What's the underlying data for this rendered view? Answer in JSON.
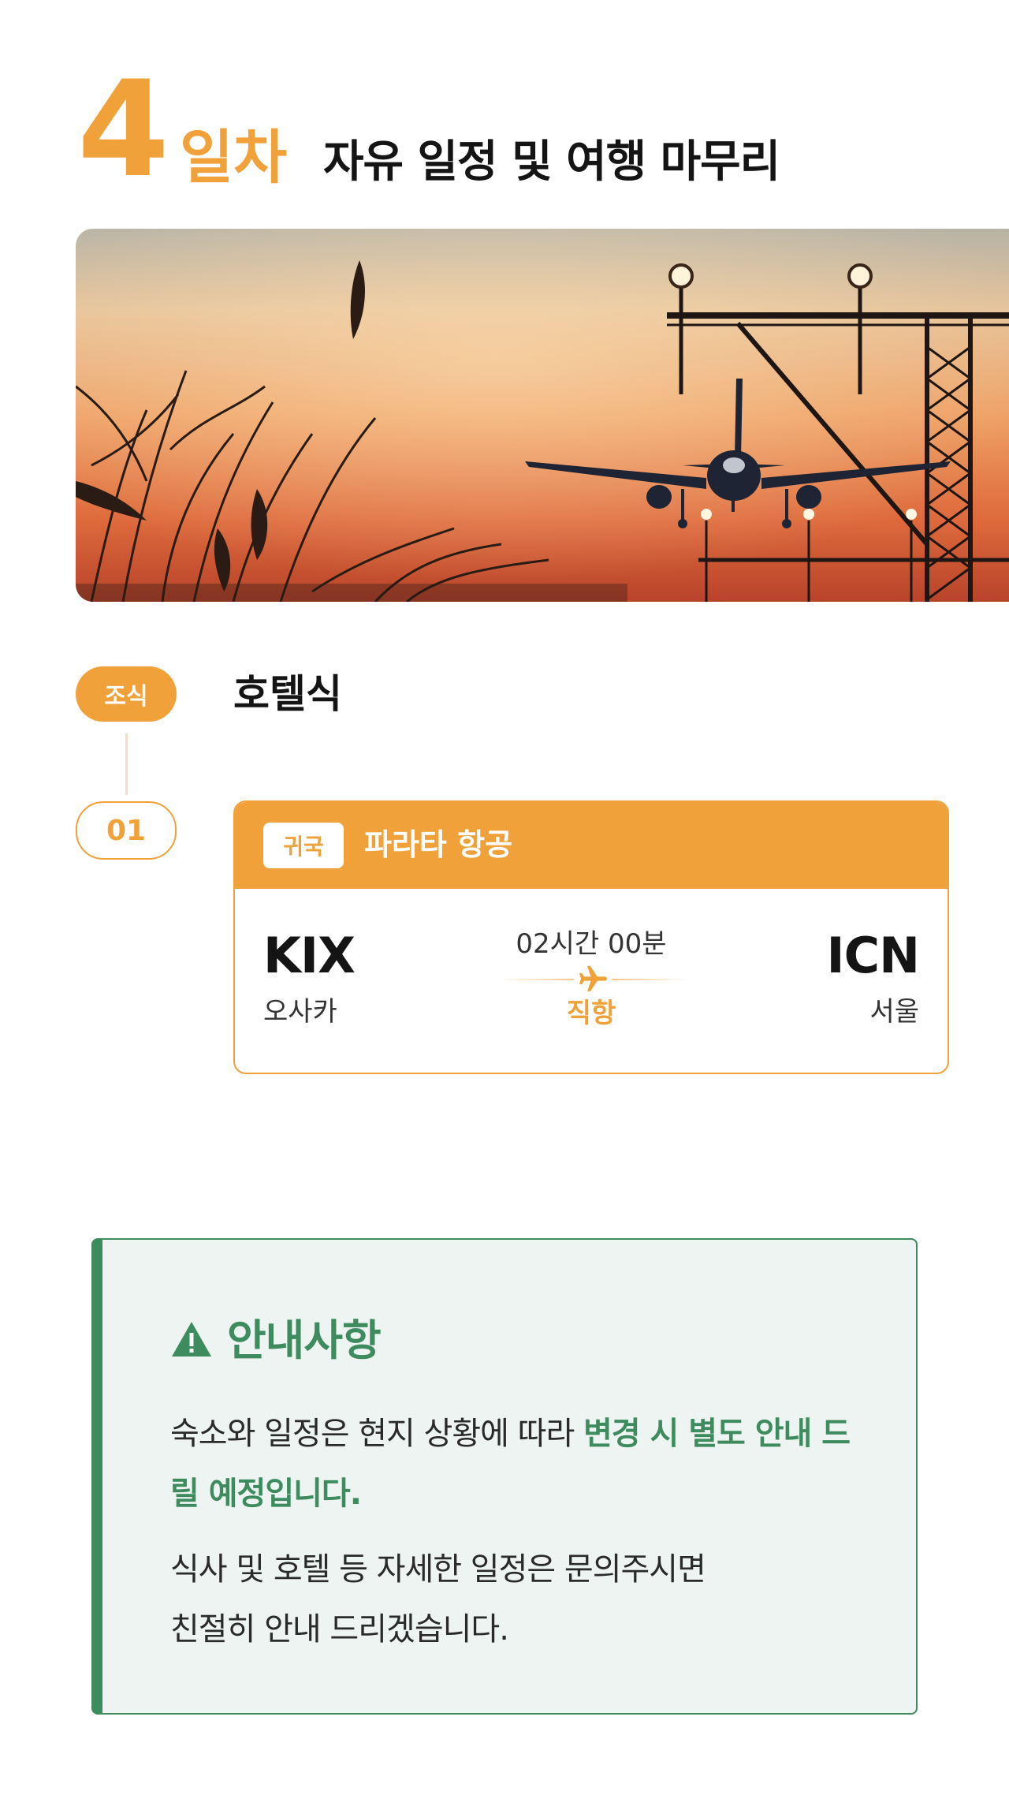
{
  "day": {
    "number": "4",
    "unit": "일차",
    "title": "자유 일정 및 여행 마무리"
  },
  "timeline": {
    "meal_tag": "조식",
    "meal_text": "호텔식",
    "step_label": "01"
  },
  "flight": {
    "badge": "귀국",
    "airline": "파라타 항공",
    "origin_code": "KIX",
    "origin_city": "오사카",
    "destination_code": "ICN",
    "destination_city": "서울",
    "duration": "02시간 00분",
    "type": "직항",
    "plane_icon": "airplane-icon"
  },
  "notice": {
    "icon": "warning-icon",
    "title": "안내사항",
    "p1_plain": "숙소와 일정은 현지 상황에 따라 ",
    "p1_highlight": "변경 시 별도 안내 드릴 예정입니다.",
    "p2_line1": "식사 및 호텔 등 자세한 일정은 문의주시면",
    "p2_line2": "친절히 안내 드리겠습니다."
  },
  "colors": {
    "accent_orange": "#f0a13a",
    "accent_green": "#3d8b5e",
    "notice_bg": "#eef4f1"
  }
}
